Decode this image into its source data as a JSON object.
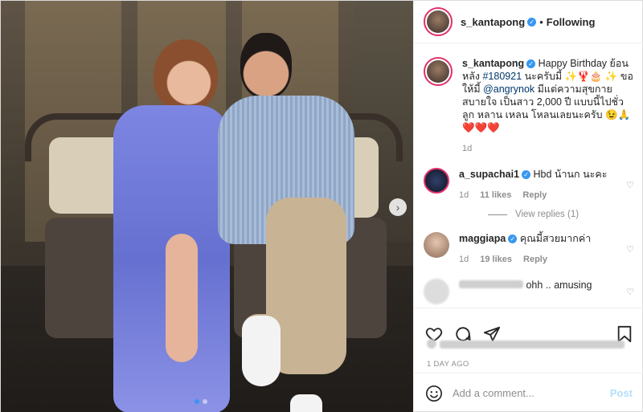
{
  "post": {
    "author": "s_kantapong",
    "separator": "•",
    "follow_label": "Following",
    "caption_user": "s_kantapong",
    "caption_text_1": "Happy Birthday ย้อนหลัง ",
    "caption_tag": "#180921",
    "caption_text_2": " นะครับมี้ ✨🦞🎂 ✨ ขอให้มี้ ",
    "caption_mention": "@angrynok",
    "caption_text_3": " มีแต่ความสุขกาย สบายใจ เป็นสาว 2,000 ปี แบบนี้ไปชั่วลูก หลาน เหลน โหลนเลยนะครับ 😉🙏❤️❤️❤️",
    "caption_age": "1d"
  },
  "comments": [
    {
      "user": "a_supachai1",
      "text": "Hbd น้านก นะคะ",
      "age": "1d",
      "likes": "11 likes",
      "reply": "Reply",
      "view_replies": "View replies (1)"
    },
    {
      "user": "maggiapa",
      "text": "คุณมี้สวยมากค่า",
      "age": "1d",
      "likes": "19 likes",
      "reply": "Reply"
    },
    {
      "user": "",
      "text": "ohh .. amusing"
    }
  ],
  "actions": {
    "icons": [
      "heart-icon",
      "comment-icon",
      "share-icon",
      "bookmark-icon"
    ]
  },
  "date": "1 DAY AGO",
  "add_comment": {
    "placeholder": "Add a comment...",
    "post_label": "Post"
  },
  "nav": {
    "next_glyph": "›"
  },
  "colors": {
    "accent": "#3897f0",
    "dress": "#6f78d9",
    "ring": "#e1306c"
  }
}
